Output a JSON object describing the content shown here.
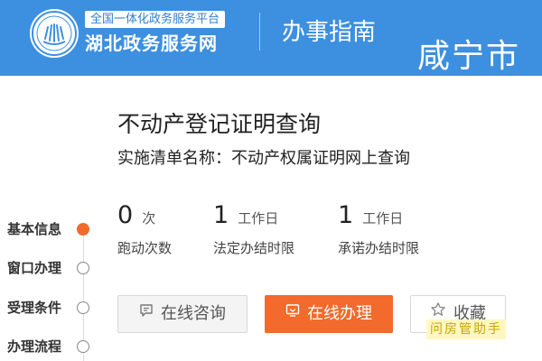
{
  "header": {
    "brand_top": "全国一体化政务服务平台",
    "brand_main": "湖北政务服务网",
    "section_title": "办事指南",
    "city": "咸宁市"
  },
  "item": {
    "title": "不动产登记证明查询",
    "impl_label": "实施清单名称：",
    "impl_name": "不动产权属证明网上查询"
  },
  "stats": [
    {
      "value": "0",
      "unit": "次",
      "label": "跑动次数"
    },
    {
      "value": "1",
      "unit": "工作日",
      "label": "法定办结时限"
    },
    {
      "value": "1",
      "unit": "工作日",
      "label": "承诺办结时限"
    }
  ],
  "buttons": {
    "consult": "在线咨询",
    "online": "在线办理",
    "favorite": "收藏"
  },
  "nav": [
    {
      "label": "基本信息",
      "active": true
    },
    {
      "label": "窗口办理",
      "active": false
    },
    {
      "label": "受理条件",
      "active": false
    },
    {
      "label": "办理流程",
      "active": false
    }
  ],
  "watermark": "问房管助手",
  "colors": {
    "header_bg": "#3d8fdf",
    "accent": "#f26a2c"
  }
}
